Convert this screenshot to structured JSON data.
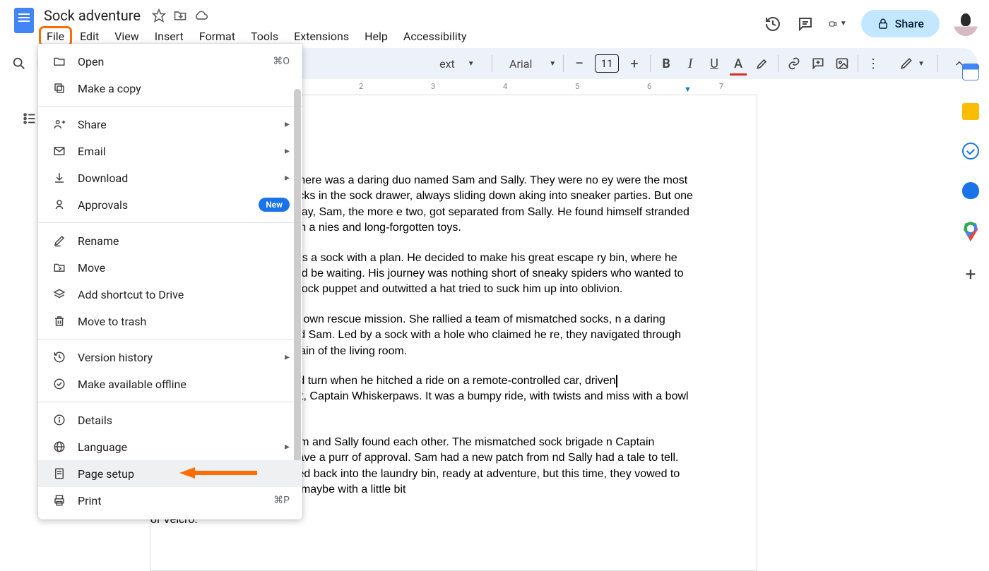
{
  "doc": {
    "title": "Sock adventure"
  },
  "menubar": [
    "File",
    "Edit",
    "View",
    "Insert",
    "Format",
    "Tools",
    "Extensions",
    "Help",
    "Accessibility"
  ],
  "share_label": "Share",
  "toolbar": {
    "style": "Normal text",
    "font": "Arial",
    "font_size": "11",
    "bold": "B",
    "italic": "I",
    "underline": "U",
    "text_color": "A"
  },
  "ruler": {
    "ticks": [
      "2",
      "3",
      "4",
      "5",
      "6",
      "7"
    ]
  },
  "dropdown": {
    "items": [
      {
        "icon": "open",
        "label": "Open",
        "right": "⌘O",
        "kind": "shortcut"
      },
      {
        "icon": "copy",
        "label": "Make a copy"
      },
      {
        "divider": true
      },
      {
        "icon": "share",
        "label": "Share",
        "right": "▸",
        "kind": "submenu"
      },
      {
        "icon": "email",
        "label": "Email",
        "right": "▸",
        "kind": "submenu"
      },
      {
        "icon": "download",
        "label": "Download",
        "right": "▸",
        "kind": "submenu"
      },
      {
        "icon": "approvals",
        "label": "Approvals",
        "right": "New",
        "kind": "badge"
      },
      {
        "divider": true
      },
      {
        "icon": "rename",
        "label": "Rename"
      },
      {
        "icon": "move",
        "label": "Move"
      },
      {
        "icon": "shortcut",
        "label": "Add shortcut to Drive"
      },
      {
        "icon": "trash",
        "label": "Move to trash"
      },
      {
        "divider": true
      },
      {
        "icon": "history",
        "label": "Version history",
        "right": "▸",
        "kind": "submenu"
      },
      {
        "icon": "offline",
        "label": "Make available offline"
      },
      {
        "divider": true
      },
      {
        "icon": "details",
        "label": "Details"
      },
      {
        "icon": "language",
        "label": "Language",
        "right": "▸",
        "kind": "submenu"
      },
      {
        "icon": "page-setup",
        "label": "Page setup",
        "hover": true,
        "arrow": true
      },
      {
        "icon": "print",
        "label": "Print",
        "right": "⌘P",
        "kind": "shortcut"
      }
    ]
  },
  "body": {
    "p1": "uled by socks, there was a daring duo named Sam and Sally. They were no ey were the most adventurous socks in the sock drawer, always sliding down aking into sneaker parties. But one fateful laundry day, Sam, the more e two, got separated from Sally. He found himself stranded under the bed, in a nies and long-forgotten toys.",
    "p2": "any sock; he was a sock with a plan. He decided to make his great escape ry bin, where he knew Sally would be waiting. His journey was nothing short of sneaky spiders who wanted to turn him into a sock puppet and outwitted a hat tried to suck him up into oblivion.",
    "p3": "was plotting her own rescue mission. She rallied a team of mismatched socks, n a daring adventure to find Sam. Led by a sock with a hole who claimed he re, they navigated through the perilous terrain of the living room.",
    "p4a": "hings took a wild turn when he hitched a ride on a remote-controlled car, driven",
    "p4b": "an the family cat, Captain Whiskerpaws. It was a bumpy ride, with twists and miss with a bowl of dog water!",
    "p5": "atic reunion, Sam and Sally found each other. The mismatched sock brigade n Captain Whiskerpaws gave a purr of approval. Sam had a new patch from nd Sally had a tale to tell. They were tossed back into the laundry bin, ready at adventure, but this time, they vowed to stick together – maybe with a little bit",
    "p5_tail": "of Velcro."
  }
}
